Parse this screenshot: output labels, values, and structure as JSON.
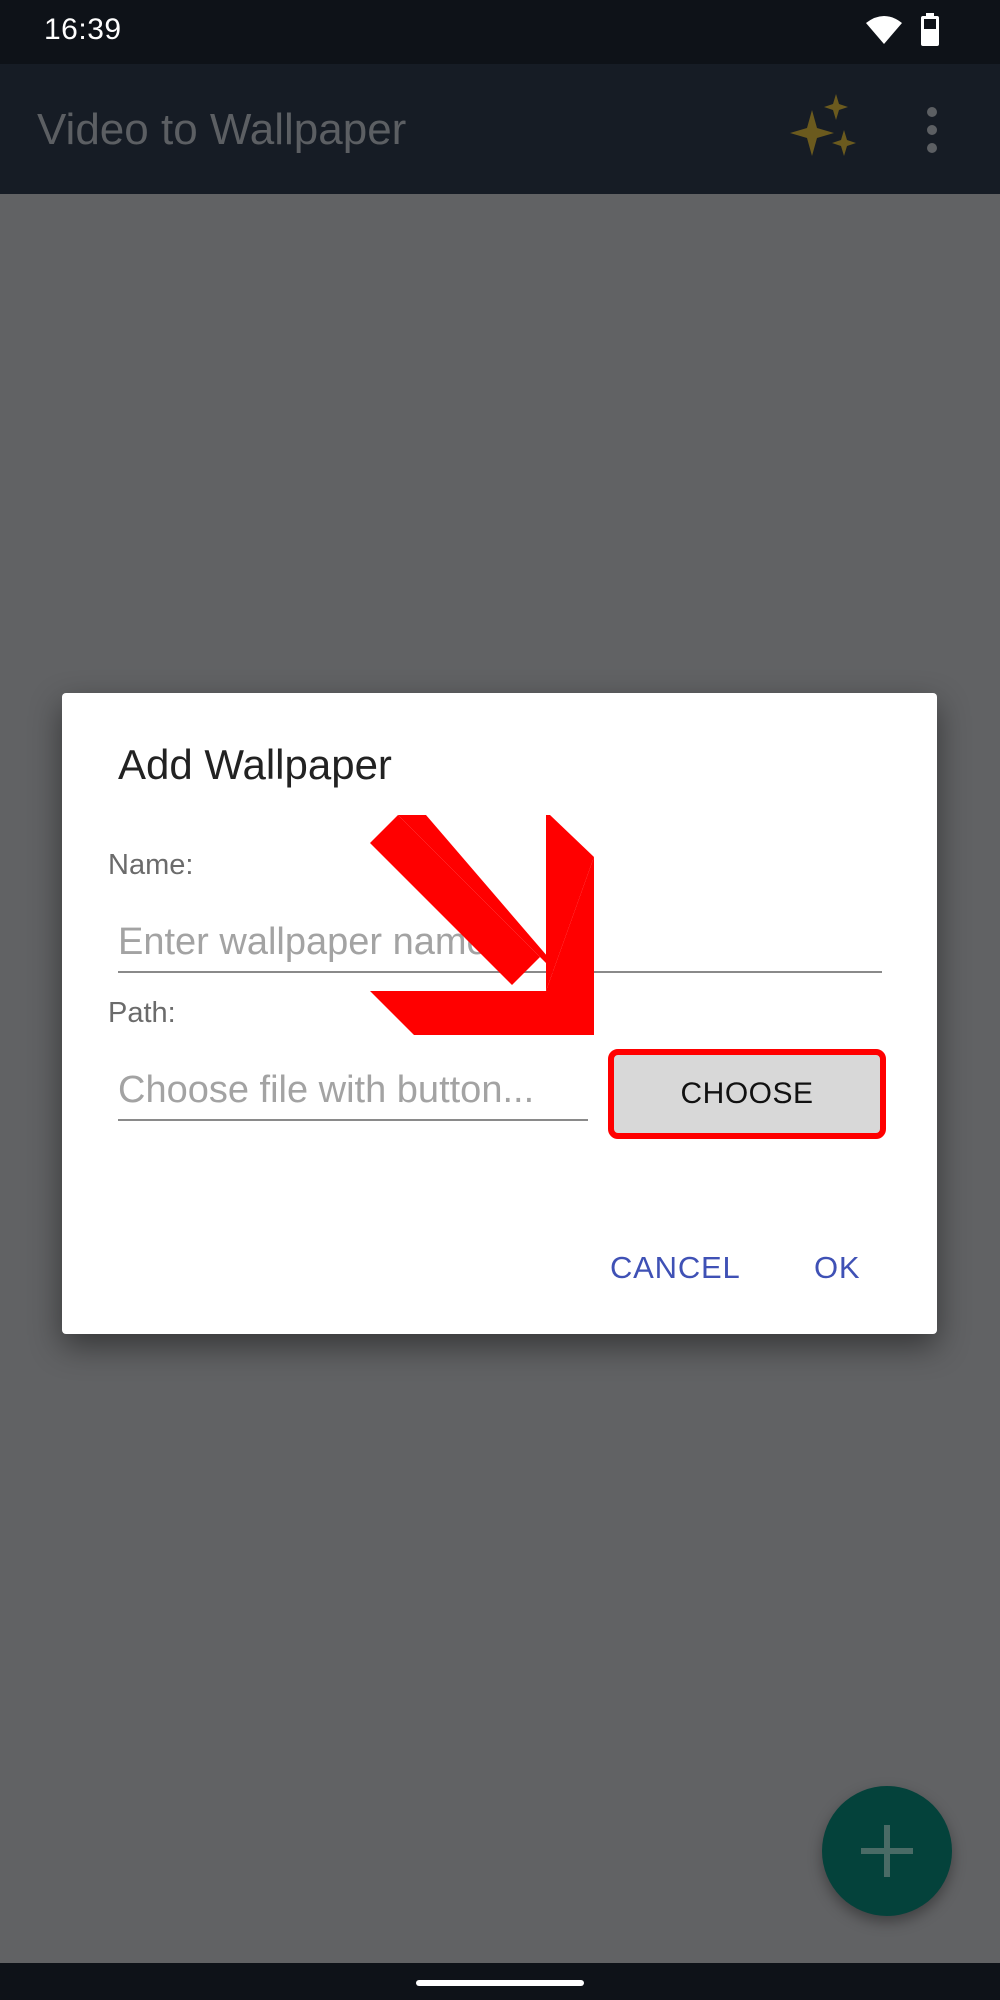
{
  "status_bar": {
    "time": "16:39",
    "wifi_icon": "wifi-icon",
    "battery_icon": "battery-icon"
  },
  "app_bar": {
    "title": "Video to Wallpaper",
    "sparkle_icon": "sparkle-icon",
    "sparkle_color": "#6b5a1e",
    "overflow_icon": "more-vert-icon"
  },
  "dialog": {
    "title": "Add Wallpaper",
    "name_label": "Name:",
    "name_placeholder": "Enter wallpaper name",
    "path_label": "Path:",
    "path_placeholder": "Choose file with button...",
    "choose_label": "CHOOSE",
    "cancel_label": "CANCEL",
    "ok_label": "OK",
    "highlight_color": "#ff0000",
    "action_color": "#3f51b5"
  },
  "fab": {
    "icon": "add-icon",
    "color": "#04423b"
  },
  "annotation": {
    "icon": "arrow-down-right-icon",
    "color": "#ff0000"
  }
}
